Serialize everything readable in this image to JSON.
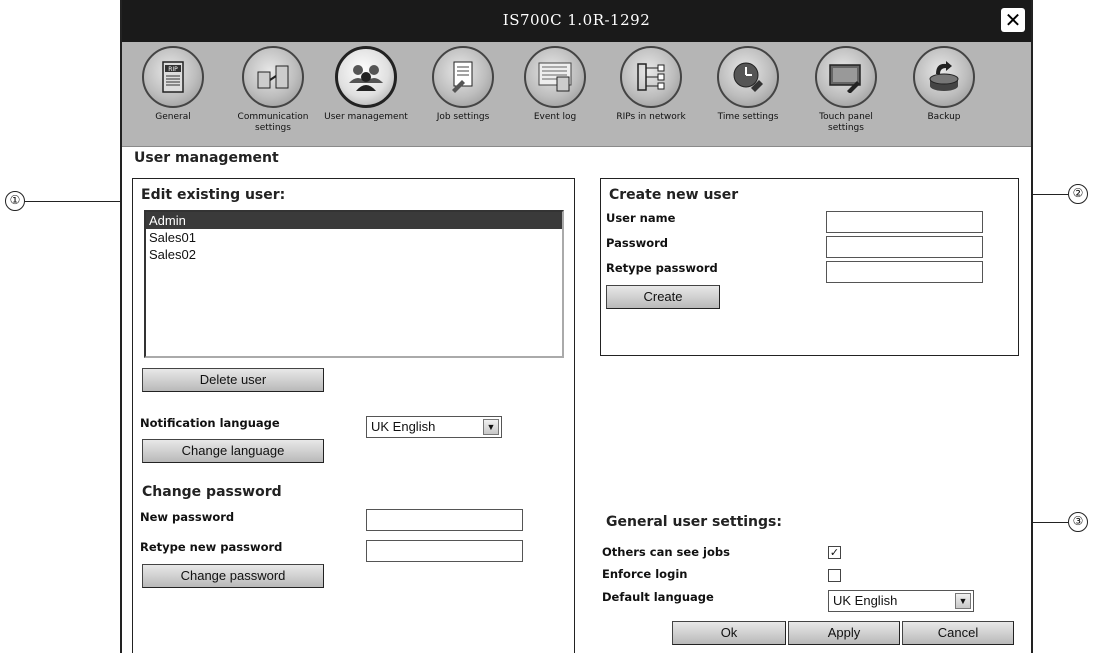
{
  "window": {
    "title": "IS700C 1.0R-1292",
    "close_icon": "close-icon"
  },
  "toolbar": {
    "items": [
      {
        "label": "General",
        "icon": "rip-server-icon"
      },
      {
        "label": "Communication settings",
        "icon": "communication-icon"
      },
      {
        "label": "User management",
        "icon": "users-icon",
        "active": true
      },
      {
        "label": "Job settings",
        "icon": "job-settings-icon"
      },
      {
        "label": "Event log",
        "icon": "event-log-icon"
      },
      {
        "label": "RIPs in network",
        "icon": "network-icon"
      },
      {
        "label": "Time settings",
        "icon": "clock-icon"
      },
      {
        "label": "Touch panel settings",
        "icon": "touch-panel-icon"
      },
      {
        "label": "Backup",
        "icon": "backup-icon"
      }
    ]
  },
  "page": {
    "title": "User management"
  },
  "edit_user": {
    "heading": "Edit existing user:",
    "users": [
      "Admin",
      "Sales01",
      "Sales02"
    ],
    "selected_user": "Admin",
    "delete_button": "Delete user",
    "notification_language_label": "Notification language",
    "notification_language_value": "UK English",
    "change_language_button": "Change language",
    "change_password_heading": "Change password",
    "new_password_label": "New password",
    "retype_new_password_label": "Retype new password",
    "change_password_button": "Change password"
  },
  "create_user": {
    "heading": "Create new user",
    "user_name_label": "User name",
    "password_label": "Password",
    "retype_password_label": "Retype password",
    "create_button": "Create"
  },
  "general_settings": {
    "heading": "General user settings:",
    "others_can_see_jobs_label": "Others can see jobs",
    "others_can_see_jobs_checked": true,
    "enforce_login_label": "Enforce login",
    "enforce_login_checked": false,
    "default_language_label": "Default language",
    "default_language_value": "UK English"
  },
  "footer": {
    "ok_button": "Ok",
    "apply_button": "Apply",
    "cancel_button": "Cancel"
  },
  "callouts": [
    "①",
    "②",
    "③"
  ],
  "colors": {
    "titlebar": "#1a1a1a",
    "toolbar": "#b5b5b5",
    "selected_row": "#3a3a3a"
  }
}
